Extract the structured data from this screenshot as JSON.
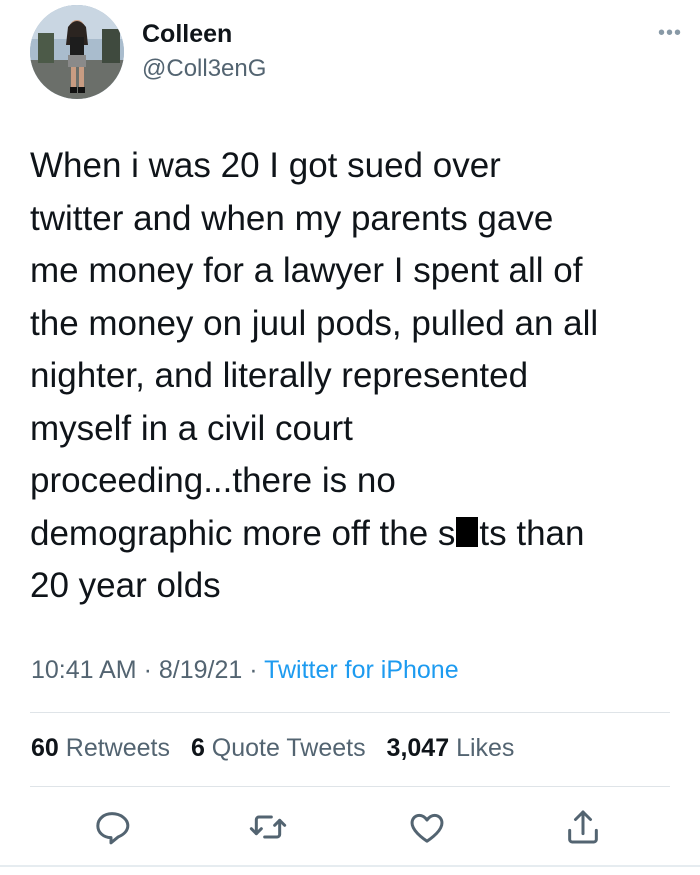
{
  "user": {
    "display_name": "Colleen",
    "handle": "@Coll3enG"
  },
  "tweet": {
    "lines": [
      "When i was 20 I got sued over",
      "twitter and when my parents gave",
      "me money for a lawyer I spent all of",
      "the money on juul pods, pulled an all",
      "nighter, and literally represented",
      "myself in a civil court",
      "proceeding...there is no",
      "demographic more off the s",
      "ts than",
      "20 year olds"
    ]
  },
  "meta": {
    "time": "10:41 AM",
    "date": "8/19/21",
    "separator": "·",
    "source": "Twitter for iPhone"
  },
  "stats": {
    "retweets_count": "60",
    "retweets_label": "Retweets",
    "quotes_count": "6",
    "quotes_label": "Quote Tweets",
    "likes_count": "3,047",
    "likes_label": "Likes"
  },
  "icons": {
    "more": "more-icon",
    "reply": "reply-icon",
    "retweet": "retweet-icon",
    "like": "like-icon",
    "share": "share-icon"
  },
  "colors": {
    "link": "#1d9bf0",
    "secondary_text": "#536471",
    "icon": "#536471"
  }
}
